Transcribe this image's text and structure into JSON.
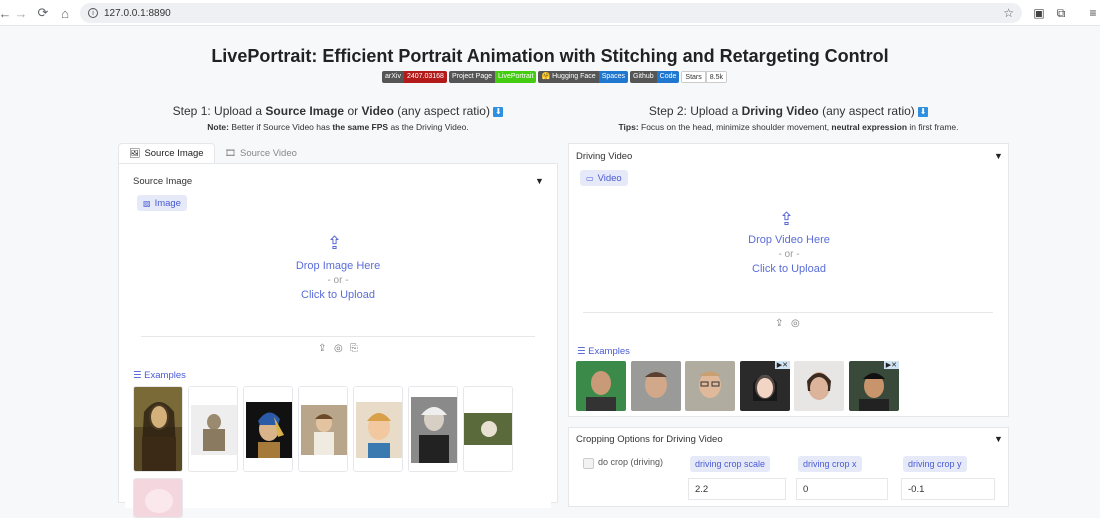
{
  "browser": {
    "url": "127.0.0.1:8890"
  },
  "header": {
    "title": "LivePortrait: Efficient Portrait Animation with Stitching and Retargeting Control",
    "badges": [
      {
        "left": "arXiv",
        "right": "2407.03168"
      },
      {
        "left": "Project Page",
        "right": "LivePortrait"
      },
      {
        "left": "🤗 Hugging Face",
        "right": "Spaces"
      },
      {
        "left": "Github",
        "right": "Code"
      },
      {
        "left": "Stars",
        "right": "8.5k"
      }
    ]
  },
  "step1": {
    "prefix": "Step 1: Upload a ",
    "bold1": "Source Image",
    "mid": " or ",
    "bold2": "Video",
    "suffix": " (any aspect ratio)",
    "note_label": "Note:",
    "note_text1": " Better if Source Video has ",
    "note_bold": "the same FPS",
    "note_text2": " as the Driving Video."
  },
  "step2": {
    "prefix": "Step 2: Upload a ",
    "bold1": "Driving Video",
    "suffix": " (any aspect ratio)",
    "tips_label": "Tips:",
    "tips_text1": " Focus on the head, minimize shoulder movement, ",
    "tips_bold": "neutral expression",
    "tips_text2": " in first frame."
  },
  "left": {
    "tabs": [
      {
        "label": "Source Image",
        "active": true
      },
      {
        "label": "Source Video",
        "active": false
      }
    ],
    "section_label": "Source Image",
    "chip_label": "Image",
    "drop_text": "Drop Image Here",
    "or_text": "- or -",
    "click_text": "Click to Upload",
    "examples_label": "Examples"
  },
  "right": {
    "section_label": "Driving Video",
    "chip_label": "Video",
    "drop_text": "Drop Video Here",
    "or_text": "- or -",
    "click_text": "Click to Upload",
    "examples_label": "Examples"
  },
  "crop": {
    "section_label": "Cropping Options for Driving Video",
    "checkbox_label": "do crop (driving)",
    "fields": [
      {
        "label": "driving crop scale",
        "value": "2.2"
      },
      {
        "label": "driving crop x",
        "value": "0"
      },
      {
        "label": "driving crop y",
        "value": "-0.1"
      }
    ]
  },
  "colors": {
    "accent": "#4a5bd4",
    "chip_bg": "#e5e9f8"
  }
}
